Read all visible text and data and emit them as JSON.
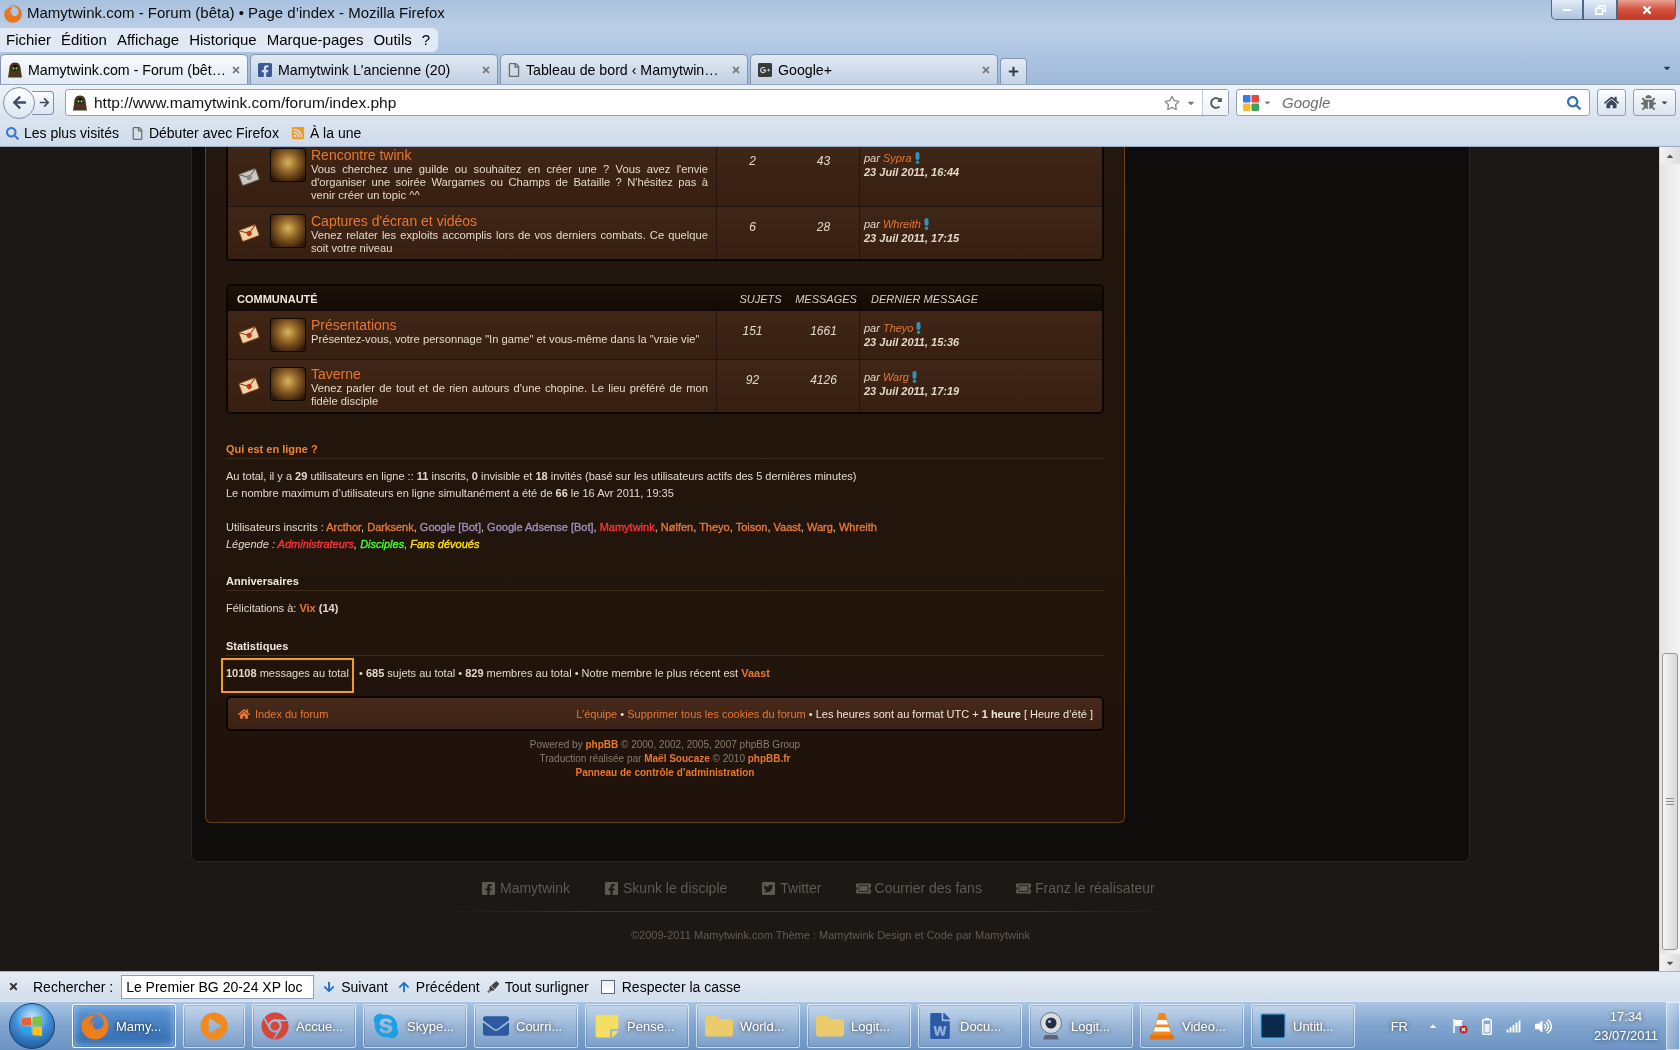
{
  "window": {
    "title": "Mamytwink.com - Forum (bêta) • Page d’index - Mozilla Firefox"
  },
  "menu": [
    "Fichier",
    "Édition",
    "Affichage",
    "Historique",
    "Marque-pages",
    "Outils",
    "?"
  ],
  "tabs": [
    {
      "label": "Mamytwink.com - Forum (bêt…",
      "kind": "site",
      "selected": true
    },
    {
      "label": "Mamytwink L'ancienne (20)",
      "kind": "facebook",
      "selected": false
    },
    {
      "label": "Tableau de bord ‹ Mamytwin…",
      "kind": "page",
      "selected": false
    },
    {
      "label": "Google+",
      "kind": "googleplus",
      "selected": false
    }
  ],
  "address_bar": {
    "value": "http://www.mamytwink.com/forum/index.php"
  },
  "search_box": {
    "placeholder": "Google"
  },
  "bookmarks": [
    {
      "label": "Les plus visités",
      "kind": "smart"
    },
    {
      "label": "Débuter avec Firefox",
      "kind": "page"
    },
    {
      "label": "À la une",
      "kind": "feed"
    }
  ],
  "page": {
    "categories": [
      {
        "rows": [
          {
            "title": "Rencontre twink",
            "description": "Vous cherchez une guilde ou souhaitez en créer une ? Vous avez l'envie d'organiser une soirée Wargames ou Champs de Bataille ? N'hésitez pas à venir créer un topic ^^",
            "topics": "2",
            "posts": "43",
            "unread": false,
            "last_post": {
              "prefix": "par",
              "author": "Sypra",
              "date": "23 Juil 2011, 16:44"
            }
          },
          {
            "title": "Captures d'écran et vidéos",
            "description": "Venez relater les exploits accomplis lors de vos derniers combats. Ce quelque soit votre niveau",
            "topics": "6",
            "posts": "28",
            "unread": true,
            "last_post": {
              "prefix": "par",
              "author": "Whreith",
              "date": "23 Juil 2011, 17:15"
            }
          }
        ]
      },
      {
        "header": {
          "title": "COMMUNAUTÉ",
          "columns": [
            "SUJETS",
            "MESSAGES",
            "DERNIER MESSAGE"
          ]
        },
        "rows": [
          {
            "title": "Présentations",
            "description": "Présentez-vous, votre personnage \"In game\" et vous-même dans la \"vraie vie\"",
            "topics": "151",
            "posts": "1661",
            "unread": true,
            "last_post": {
              "prefix": "par",
              "author": "Theyo",
              "date": "23 Juil 2011, 15:36"
            }
          },
          {
            "title": "Taverne",
            "description": "Venez parler de tout et de rien autours d'une chopine. Le lieu préféré de mon fidèle disciple",
            "topics": "92",
            "posts": "4126",
            "unread": true,
            "last_post": {
              "prefix": "par",
              "author": "Warg",
              "date": "23 Juil 2011, 17:19"
            }
          }
        ]
      }
    ],
    "who_is_online": {
      "title": "Qui est en ligne ?",
      "lines": [
        "Au total, il y a **29** utilisateurs en ligne :: **11** inscrits, **0** invisible et **18** invités (basé sur les utilisateurs actifs des 5 dernières minutes)",
        "Le nombre maximum d’utilisateurs en ligne simultanément a été de **66** le 16 Avr 2011, 19:35"
      ],
      "registered": {
        "label": "Utilisateurs inscrits :",
        "separator": ",",
        "users": [
          {
            "name": "Arcthor",
            "color": "#e27a3b"
          },
          {
            "name": "Darksenk",
            "color": "#e27a3b"
          },
          {
            "name": "Google [Bot]",
            "color": "#9d90bb"
          },
          {
            "name": "Google Adsense [Bot]",
            "color": "#9d90bb"
          },
          {
            "name": "Mamytwink",
            "color": "#ff3333"
          },
          {
            "name": "Nølfen",
            "color": "#e27a3b"
          },
          {
            "name": "Theyo",
            "color": "#e27a3b"
          },
          {
            "name": "Toison",
            "color": "#e27a3b"
          },
          {
            "name": "Vaast",
            "color": "#e27a3b"
          },
          {
            "name": "Warg",
            "color": "#e27a3b"
          },
          {
            "name": "Whreith",
            "color": "#e27a3b"
          }
        ]
      },
      "legend": {
        "label": "Légende :",
        "separator": ",",
        "groups": [
          {
            "name": "Administrateurs",
            "color": "#ff3333"
          },
          {
            "name": "Disciples",
            "color": "#44ff33"
          },
          {
            "name": "Fans dévoués",
            "color": "#ffe000"
          }
        ]
      }
    },
    "birthdays": {
      "title": "Anniversaires",
      "label": "Félicitations à:",
      "user": "Vix",
      "age": "(14)"
    },
    "statistics": {
      "title": "Statistiques",
      "separator": "•",
      "items": [
        {
          "text": "**10108** messages au total",
          "highlighted": true
        },
        {
          "text": "**685** sujets au total",
          "highlighted": false
        },
        {
          "text": "**829** membres au total",
          "highlighted": false
        }
      ],
      "newest": {
        "label": "Notre membre le plus récent est",
        "user": "Vaast"
      }
    },
    "footer_bar": {
      "home_link": "Index du forum",
      "links": [
        "L’équipe",
        "Supprimer tous les cookies du forum"
      ],
      "separator": "•",
      "timezone": "Les heures sont au format UTC + **1 heure** [ Heure d’été ]"
    },
    "credits": [
      [
        {
          "text": "Powered by",
          "link": false
        },
        {
          "text": "phpBB",
          "link": true
        },
        {
          "text": "© 2000, 2002, 2005, 2007 phpBB Group",
          "link": false
        }
      ],
      [
        {
          "text": "Traduction réalisée par",
          "link": false
        },
        {
          "text": "Maël Soucaze",
          "link": true
        },
        {
          "text": "© 2010",
          "link": false
        },
        {
          "text": "phpBB.fr",
          "link": true
        }
      ],
      [
        {
          "text": "Panneau de contrôle d’administration",
          "link": true
        }
      ]
    ],
    "social_links": [
      {
        "label": "Mamytwink",
        "kind": "facebook"
      },
      {
        "label": "Skunk le disciple",
        "kind": "facebook"
      },
      {
        "label": "Twitter",
        "kind": "twitter"
      },
      {
        "label": "Courrier des fans",
        "kind": "mail"
      },
      {
        "label": "Franz le réalisateur",
        "kind": "mail"
      }
    ],
    "copyright": "©2009-2011 Mamytwink.com Thème : Mamytwink Design et Code par Mamytwink"
  },
  "find_bar": {
    "label": "Rechercher :",
    "value": "Le Premier BG 20-24 XP loc",
    "buttons": [
      {
        "label": "Suivant",
        "kind": "next"
      },
      {
        "label": "Précédent",
        "kind": "previous"
      },
      {
        "label": "Tout surligner",
        "kind": "highlight"
      }
    ],
    "match_case": {
      "label": "Respecter la casse",
      "checked": false
    }
  },
  "taskbar": {
    "items": [
      {
        "label": "Mamy...",
        "kind": "firefox",
        "selected": true
      },
      {
        "kind": "mediaplayer",
        "selected": false
      },
      {
        "label": "Accue...",
        "kind": "chrome",
        "selected": false
      },
      {
        "label": "Skype...",
        "kind": "skype",
        "selected": false
      },
      {
        "label": "Courri...",
        "kind": "mail",
        "selected": false
      },
      {
        "label": "Pense...",
        "kind": "notes",
        "selected": false
      },
      {
        "label": "World...",
        "kind": "folder",
        "selected": false
      },
      {
        "label": "Logit...",
        "kind": "folder",
        "selected": false
      },
      {
        "label": "Docu...",
        "kind": "word",
        "selected": false
      },
      {
        "label": "Logit...",
        "kind": "webcam",
        "selected": false
      },
      {
        "label": "Video...",
        "kind": "vlc",
        "selected": false
      },
      {
        "label": "Untitl...",
        "kind": "photoshop",
        "selected": false
      }
    ],
    "language": "FR",
    "clock": {
      "time": "17:34",
      "date": "23/07/2011"
    }
  }
}
